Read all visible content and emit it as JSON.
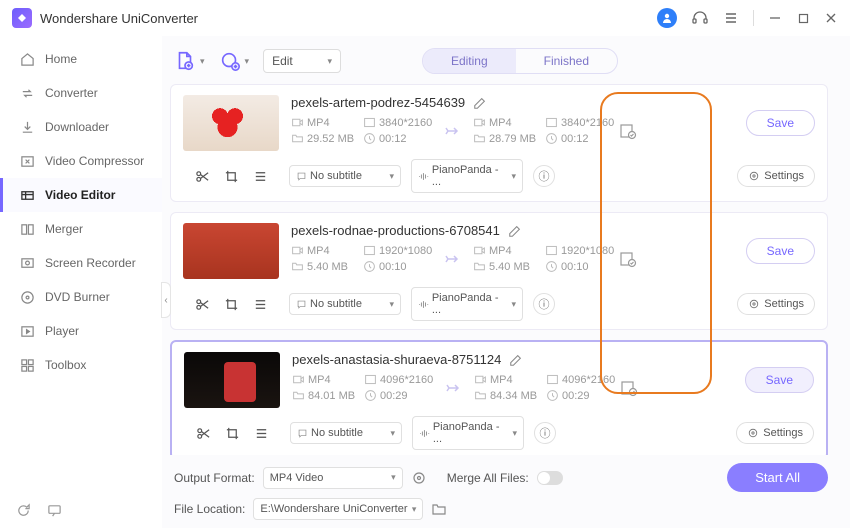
{
  "app": {
    "title": "Wondershare UniConverter"
  },
  "sidebar": {
    "items": [
      {
        "label": "Home"
      },
      {
        "label": "Converter"
      },
      {
        "label": "Downloader"
      },
      {
        "label": "Video Compressor"
      },
      {
        "label": "Video Editor"
      },
      {
        "label": "Merger"
      },
      {
        "label": "Screen Recorder"
      },
      {
        "label": "DVD Burner"
      },
      {
        "label": "Player"
      },
      {
        "label": "Toolbox"
      }
    ]
  },
  "header": {
    "edit_label": "Edit",
    "tabs": {
      "editing": "Editing",
      "finished": "Finished"
    }
  },
  "items": [
    {
      "name": "pexels-artem-podrez-5454639",
      "in": {
        "format": "MP4",
        "dim": "3840*2160",
        "size": "29.52 MB",
        "dur": "00:12"
      },
      "out": {
        "format": "MP4",
        "dim": "3840*2160",
        "size": "28.79 MB",
        "dur": "00:12"
      },
      "subtitle": "No subtitle",
      "audio": "PianoPanda - ...",
      "settings": "Settings",
      "save": "Save"
    },
    {
      "name": "pexels-rodnae-productions-6708541",
      "in": {
        "format": "MP4",
        "dim": "1920*1080",
        "size": "5.40 MB",
        "dur": "00:10"
      },
      "out": {
        "format": "MP4",
        "dim": "1920*1080",
        "size": "5.40 MB",
        "dur": "00:10"
      },
      "subtitle": "No subtitle",
      "audio": "PianoPanda - ...",
      "settings": "Settings",
      "save": "Save"
    },
    {
      "name": "pexels-anastasia-shuraeva-8751124",
      "in": {
        "format": "MP4",
        "dim": "4096*2160",
        "size": "84.01 MB",
        "dur": "00:29"
      },
      "out": {
        "format": "MP4",
        "dim": "4096*2160",
        "size": "84.34 MB",
        "dur": "00:29"
      },
      "subtitle": "No subtitle",
      "audio": "PianoPanda - ...",
      "settings": "Settings",
      "save": "Save"
    }
  ],
  "footer": {
    "output_format_label": "Output Format:",
    "output_format_value": "MP4 Video",
    "merge_label": "Merge All Files:",
    "file_location_label": "File Location:",
    "file_location_value": "E:\\Wondershare UniConverter",
    "start": "Start All"
  }
}
